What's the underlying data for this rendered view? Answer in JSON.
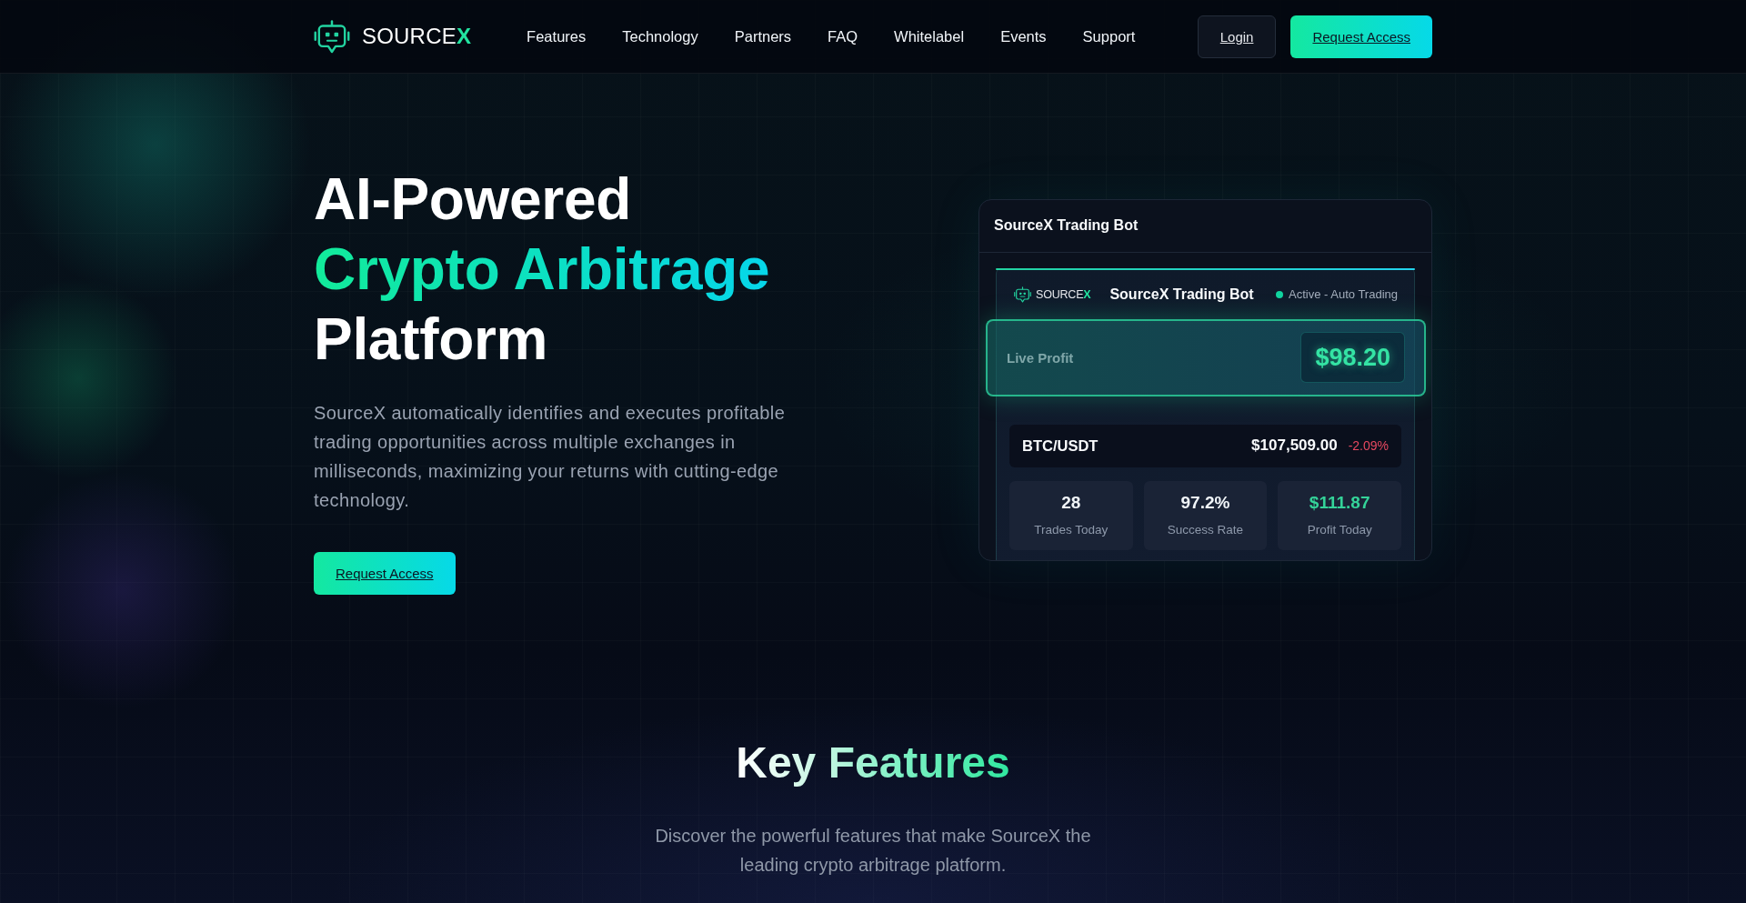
{
  "header": {
    "logo": {
      "wordmark": "SOURCE**X**"
    },
    "nav": [
      {
        "label": "Features"
      },
      {
        "label": "Technology"
      },
      {
        "label": "Partners"
      },
      {
        "label": "FAQ"
      },
      {
        "label": "Whitelabel"
      },
      {
        "label": "Events"
      },
      {
        "label": "Support"
      }
    ],
    "buttons": [
      {
        "label": "Login",
        "kind": "secondary"
      },
      {
        "label": "Request Access",
        "kind": "primary"
      }
    ]
  },
  "hero": {
    "title_lines": [
      {
        "text": "AI-Powered",
        "kind": "plain"
      },
      {
        "text": "Crypto Arbitrage",
        "kind": "gradient"
      },
      {
        "text": "Platform",
        "kind": "plain"
      }
    ],
    "description": "SourceX automatically identifies and executes profitable trading opportunities across multiple exchanges in milliseconds, maximizing your returns with cutting-edge technology.",
    "cta": {
      "label": "Request Access",
      "kind": "primary"
    }
  },
  "bot_card": {
    "title": "SourceX Trading Bot",
    "panel": {
      "logo": {
        "wordmark": "SOURCE**X**"
      },
      "title": "SourceX Trading Bot",
      "status": {
        "label": "Active - Auto Trading",
        "active": true
      },
      "live_profit": {
        "label": "Live Profit",
        "value": "$98.20"
      },
      "ticker": {
        "pair": "BTC/USDT",
        "price": "$107,509.00",
        "change": "-2.09%",
        "falling": true
      },
      "stats": [
        {
          "value": "28",
          "label": "Trades Today",
          "kind": "plain"
        },
        {
          "value": "97.2%",
          "label": "Success Rate",
          "kind": "plain"
        },
        {
          "value": "$111.87",
          "label": "Profit Today",
          "kind": "profit"
        }
      ]
    }
  },
  "features": {
    "title": "Key Features",
    "subtitle": "Discover the powerful features that make SourceX the leading crypto arbitrage platform."
  }
}
